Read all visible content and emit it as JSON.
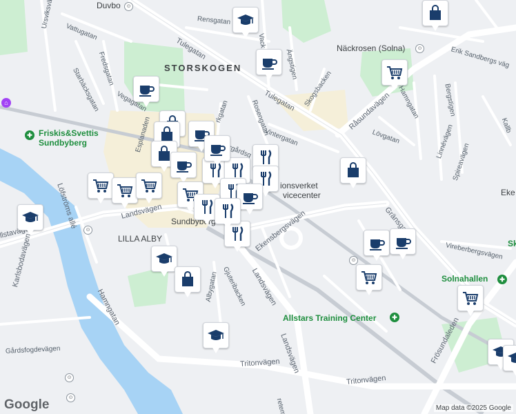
{
  "attribution": "Map data ©2025 Google",
  "logo": "Google",
  "colors": {
    "marker_icon": "#1a3d6b",
    "park": "#cdeed2",
    "water": "#a7d3f5",
    "road": "#ffffff",
    "poi_green": "#1e8e3e"
  },
  "districts": {
    "storskogen": "STORSKOGEN",
    "lilla_alby": "LILLA ALBY"
  },
  "places": {
    "sundbyberg": "Sundbyberg",
    "duvbo": "Duvbo",
    "nackrosen": "Näckrosen (Solna)",
    "solnahallen": "Solnahallen",
    "allstars": "Allstars Training Center",
    "friskis_l1": "Friskis&Svettis",
    "friskis_l2": "Sundbyberg",
    "servicecenter_l1": "ionsverket",
    "servicecenter_l2": "vicecenter",
    "sk": "Sk",
    "eke": "Eke"
  },
  "streets": {
    "urs": "Ursviksvägen",
    "vattugatan": "Vattugatan",
    "starback": "Starbäcksgatan",
    "fredsgatan": "Fredsgatan",
    "vegagatan": "Vegagatan",
    "tulegatan1": "Tulegatan",
    "tulegatan2": "Tulegatan",
    "rensgatan": "Rensgatan",
    "vack": "Vack",
    "angstigen": "Ängstigen",
    "skogsbacken": "Skogsbacken",
    "rosengatan": "Rosengatan",
    "vintergatan": "Vintergatan",
    "rasunda": "Råsundavägen",
    "erik": "Erik Sandbergs väg",
    "hamngatan": "Hamngatan",
    "bergstigen": "Bergstigen",
    "lovgatan": "Lövgatan",
    "linne": "Linnévägen",
    "spireav": "Spireavägen",
    "kallb": "Kallb",
    "gransgatan": "Gränsgatan",
    "eklundavagen": "Ekensbergsvägen",
    "virebergs": "Vireberbergsvägen",
    "frosunda": "Frösundaleden",
    "landsvagen1": "Landsvägen",
    "landsvagen2": "Landsvägen",
    "landsvagen3": "Landsvägen",
    "lofstroms": "Löfströms allé",
    "karlsbodavagen": "Karlsbodavägen",
    "allstavagen": "llstavägen",
    "hamngatan2": "Hamngatan",
    "gardsfog": "Gårdsfogdevägen",
    "tritonvagen1": "Tritonvägen",
    "tritonvagen2": "Tritonvägen",
    "albygatan": "Albygatan",
    "gjuteri": "Gjuteribacken",
    "esplanaden": "Esplanaden",
    "parkgatan": "rkgatan",
    "ragard": "rgårdsg",
    "malm": "Malm",
    "tretemaen": "retemägen",
    "ek": "Ek"
  },
  "markers": [
    {
      "type": "school"
    },
    {
      "type": "cafe"
    },
    {
      "type": "shopping-cart"
    },
    {
      "type": "cafe"
    },
    {
      "type": "shopping-bag"
    },
    {
      "type": "restaurant"
    },
    {
      "type": "restaurant"
    },
    {
      "type": "restaurant"
    },
    {
      "type": "restaurant"
    },
    {
      "type": "restaurant"
    },
    {
      "type": "cafe"
    },
    {
      "type": "cafe"
    },
    {
      "type": "shopping-bag"
    },
    {
      "type": "shopping-bag"
    },
    {
      "type": "cafe"
    },
    {
      "type": "shopping-cart"
    },
    {
      "type": "shopping-cart"
    },
    {
      "type": "shopping-cart"
    },
    {
      "type": "shopping-cart"
    },
    {
      "type": "shopping-bag"
    },
    {
      "type": "restaurant"
    },
    {
      "type": "restaurant"
    },
    {
      "type": "cafe"
    },
    {
      "type": "restaurant"
    },
    {
      "type": "school"
    },
    {
      "type": "school"
    },
    {
      "type": "shopping-bag"
    },
    {
      "type": "school"
    },
    {
      "type": "cafe"
    },
    {
      "type": "cafe"
    },
    {
      "type": "shopping-cart"
    },
    {
      "type": "shopping-cart"
    },
    {
      "type": "school"
    },
    {
      "type": "school"
    },
    {
      "type": "shopping-bag"
    }
  ]
}
